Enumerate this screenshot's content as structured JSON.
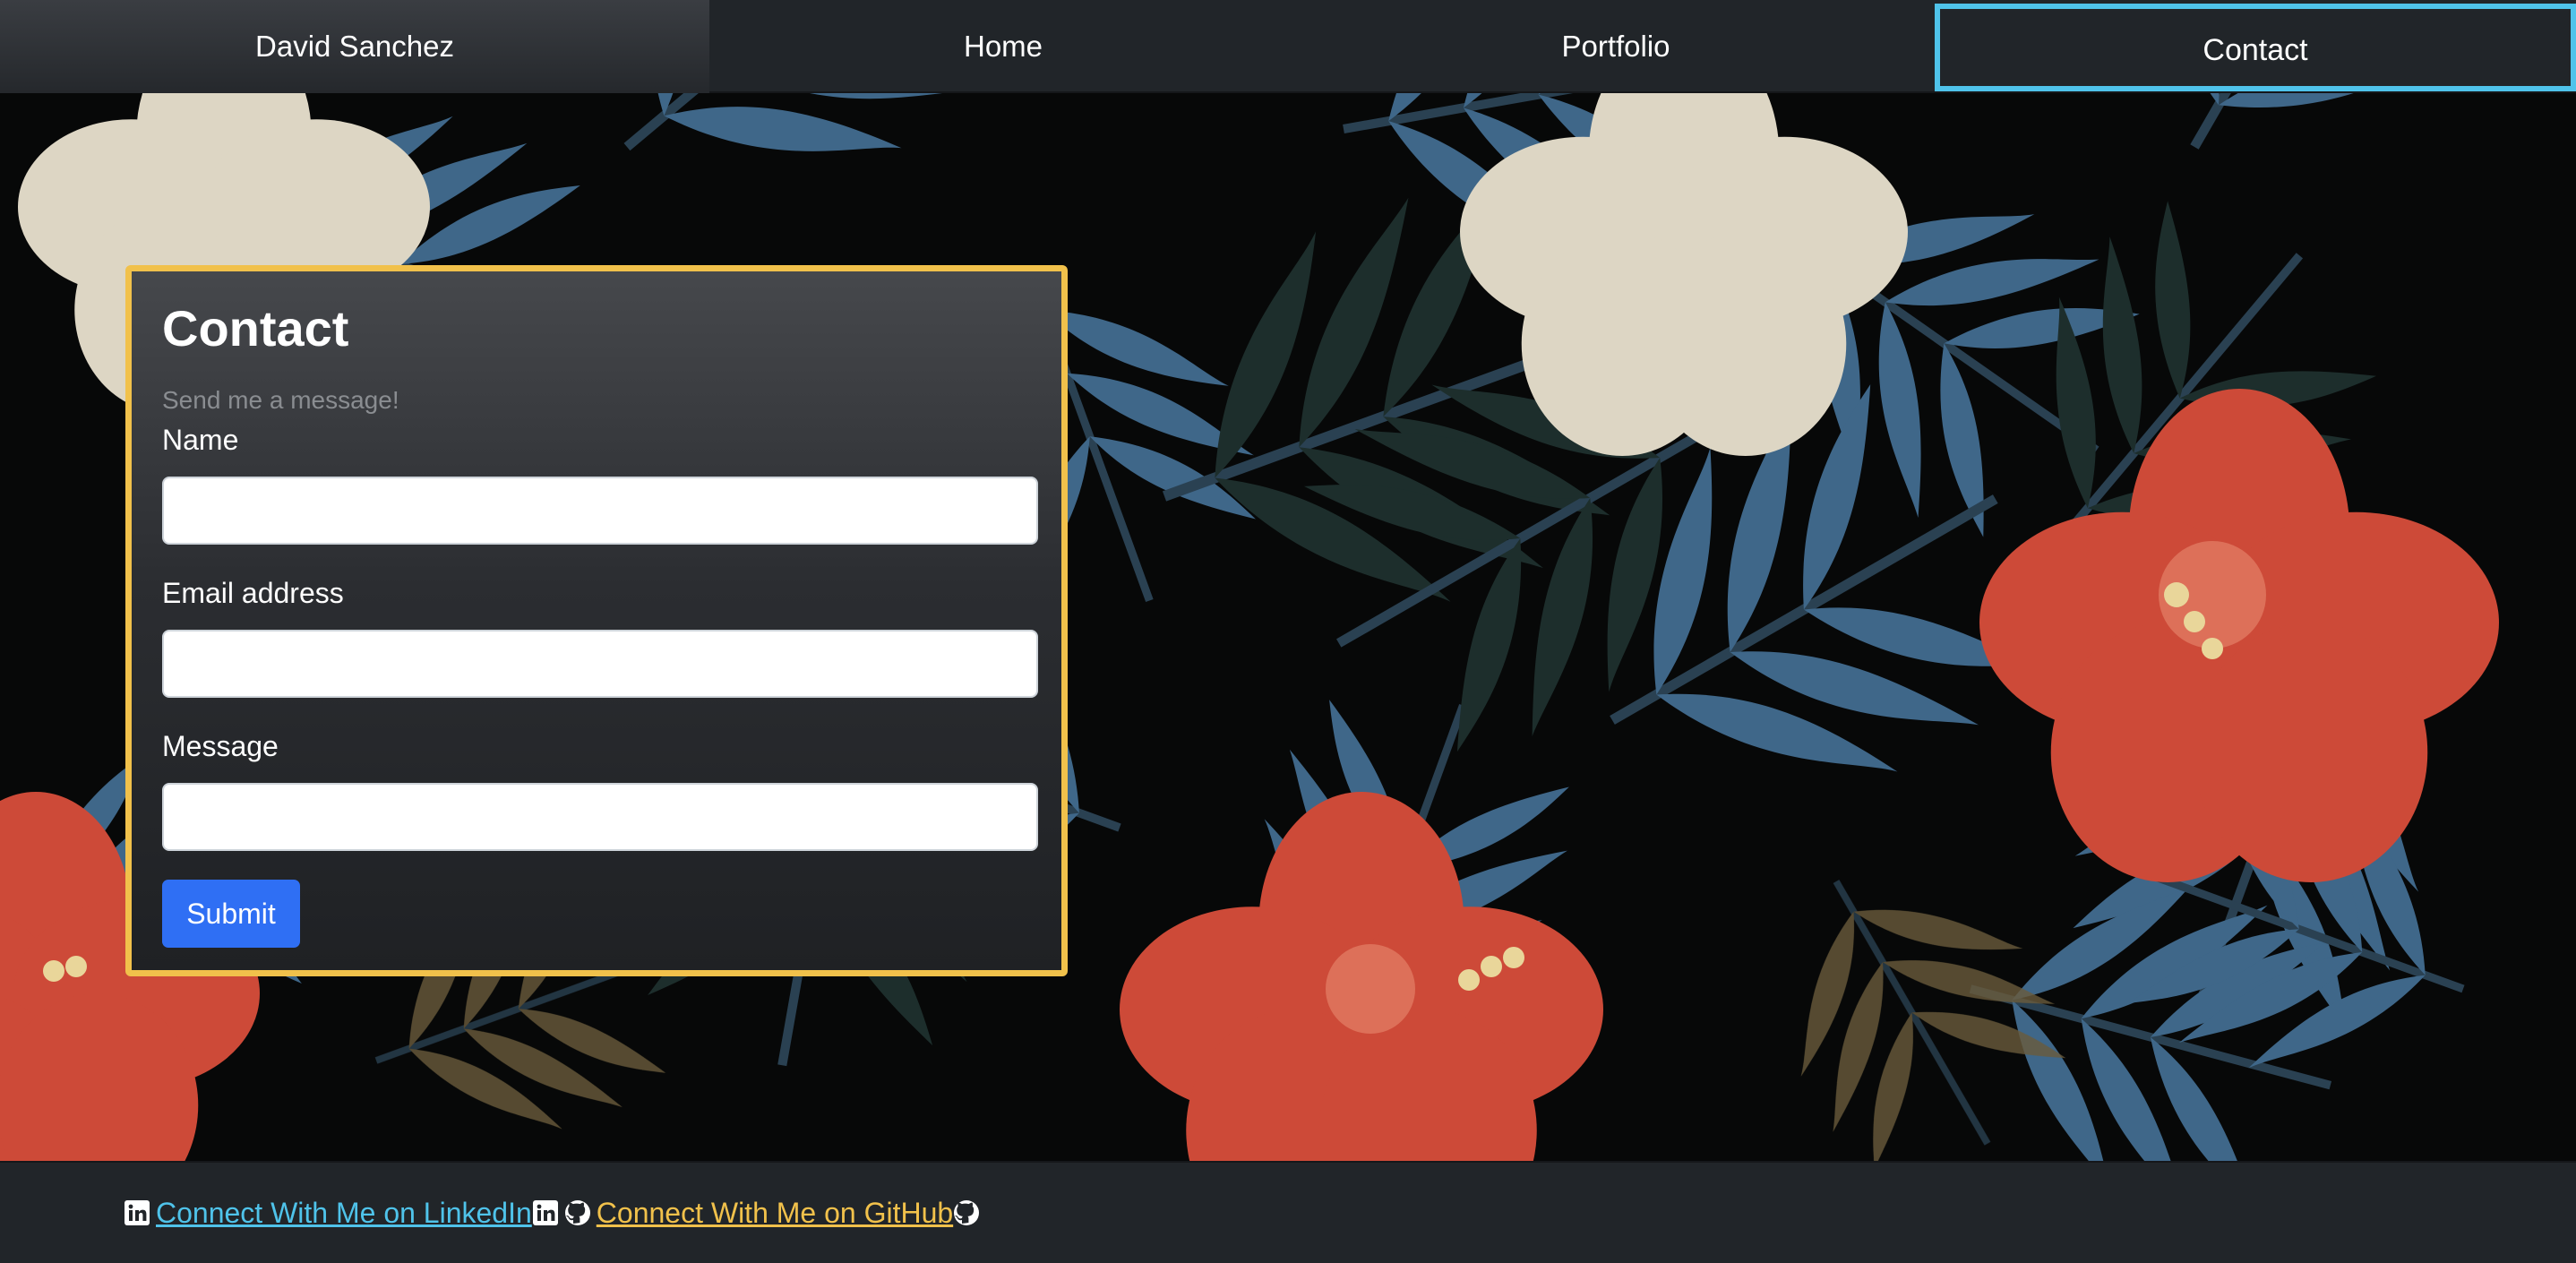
{
  "nav": {
    "brand": "David Sanchez",
    "items": [
      {
        "label": "Home"
      },
      {
        "label": "Portfolio"
      },
      {
        "label": "Contact",
        "active": true
      }
    ],
    "active_color": "#4fc3ea"
  },
  "contact_form": {
    "title": "Contact",
    "subtitle": "Send me a message!",
    "fields": {
      "name": {
        "label": "Name",
        "value": ""
      },
      "email": {
        "label": "Email address",
        "value": ""
      },
      "message": {
        "label": "Message",
        "value": ""
      }
    },
    "submit_label": "Submit",
    "border_color": "#f1c14b",
    "submit_color": "#2f6ff4"
  },
  "footer": {
    "linkedin_label": " Connect With Me on LinkedIn ",
    "github_label": " Connect With Me on GitHub ",
    "linkedin_icon": "linkedin-icon",
    "github_icon": "github-icon",
    "linkedin_color": "#4fc3ea",
    "github_color": "#f1c14b"
  },
  "background": {
    "image": "tropical-floral-pattern",
    "colors": [
      "#070808",
      "#3f6789",
      "#cd4a38",
      "#ddd6c4",
      "#6b5c3c"
    ]
  }
}
